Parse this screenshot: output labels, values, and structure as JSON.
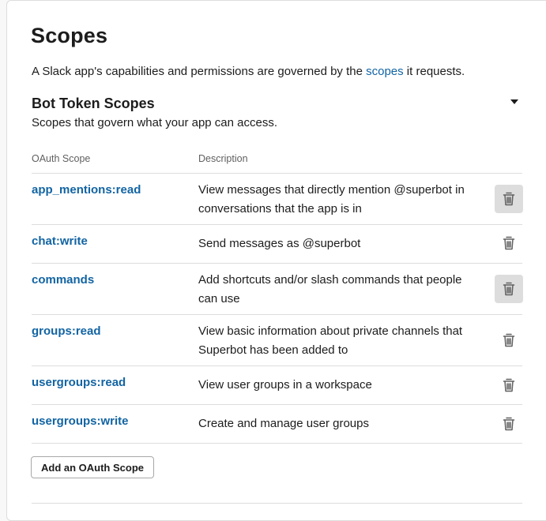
{
  "page": {
    "title": "Scopes",
    "intro_before": "A Slack app's capabilities and permissions are governed by the ",
    "intro_link": "scopes",
    "intro_after": " it requests."
  },
  "bot_scopes": {
    "title": "Bot Token Scopes",
    "description": "Scopes that govern what your app can access.",
    "columns": {
      "scope": "OAuth Scope",
      "description": "Description"
    },
    "rows": [
      {
        "scope": "app_mentions:read",
        "description": "View messages that directly mention @superbot in conversations that the app is in",
        "delete_icon": "trash-icon",
        "hovered": true
      },
      {
        "scope": "chat:write",
        "description": "Send messages as @superbot",
        "delete_icon": "trash-icon",
        "hovered": false
      },
      {
        "scope": "commands",
        "description": "Add shortcuts and/or slash commands that people can use",
        "delete_icon": "trash-icon",
        "hovered": true
      },
      {
        "scope": "groups:read",
        "description": "View basic information about private channels that Superbot has been added to",
        "delete_icon": "trash-icon",
        "hovered": false
      },
      {
        "scope": "usergroups:read",
        "description": "View user groups in a workspace",
        "delete_icon": "trash-icon",
        "hovered": false
      },
      {
        "scope": "usergroups:write",
        "description": "Create and manage user groups",
        "delete_icon": "trash-icon",
        "hovered": false
      }
    ],
    "add_button": "Add an OAuth Scope"
  },
  "colors": {
    "link": "#1264a3",
    "text": "#1d1c1d",
    "muted": "#616061",
    "border": "#dddddd"
  }
}
